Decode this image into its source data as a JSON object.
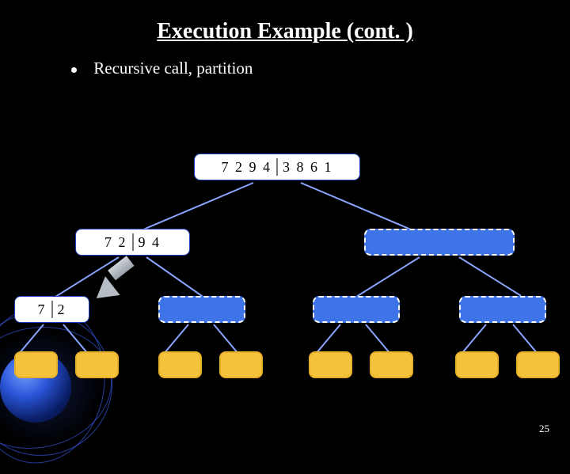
{
  "title": "Execution Example (cont. )",
  "bullet": "Recursive call, partition",
  "page_number": "25",
  "root": {
    "left": [
      "7",
      "2",
      "9",
      "4"
    ],
    "right": [
      "3",
      "8",
      "6",
      "1"
    ]
  },
  "level2_left": {
    "left": [
      "7",
      "2"
    ],
    "right": [
      "9",
      "4"
    ]
  },
  "level3_left": {
    "left": [
      "7"
    ],
    "right": [
      "2"
    ]
  }
}
